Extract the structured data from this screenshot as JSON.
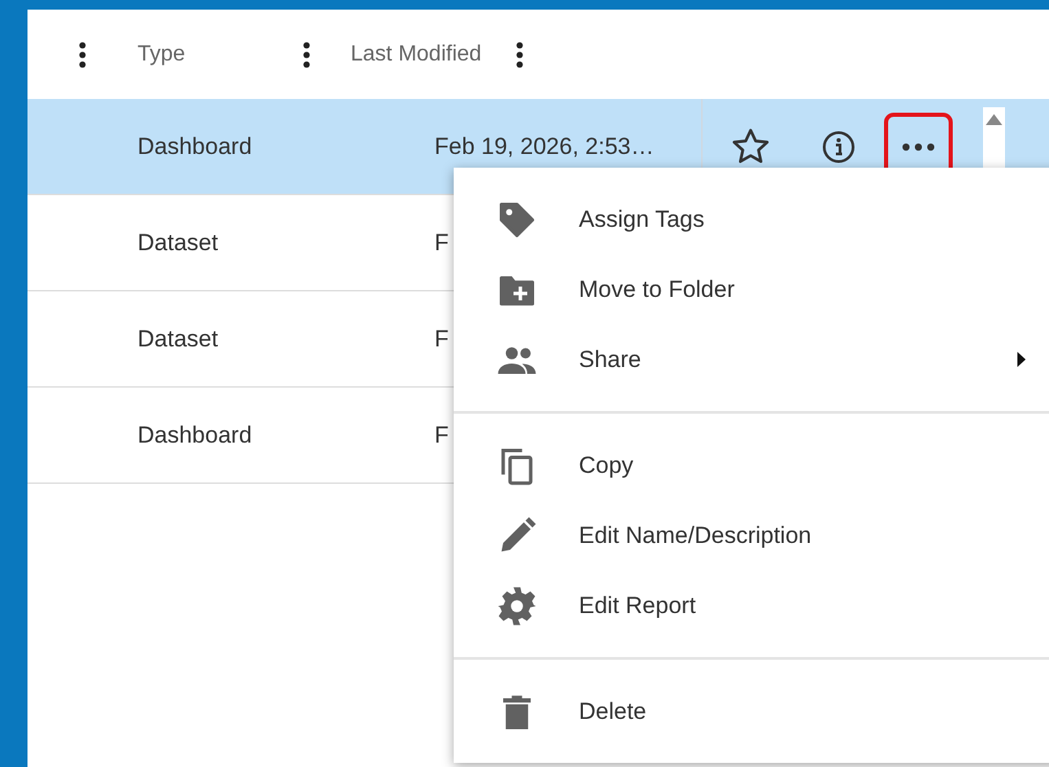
{
  "table": {
    "columns": [
      {
        "label": "Type"
      },
      {
        "label": "Last Modified"
      }
    ],
    "rows": [
      {
        "type": "Dashboard",
        "modified": "Feb 19, 2026, 2:53…",
        "selected": true
      },
      {
        "type": "Dataset",
        "modified": "F",
        "selected": false
      },
      {
        "type": "Dataset",
        "modified": "F",
        "selected": false
      },
      {
        "type": "Dashboard",
        "modified": "F",
        "selected": false
      }
    ]
  },
  "context_menu": {
    "groups": [
      [
        {
          "kind": "tag",
          "label": "Assign Tags",
          "submenu": false
        },
        {
          "kind": "folder",
          "label": "Move to Folder",
          "submenu": false
        },
        {
          "kind": "people",
          "label": "Share",
          "submenu": true
        }
      ],
      [
        {
          "kind": "copy",
          "label": "Copy",
          "submenu": false
        },
        {
          "kind": "pencil",
          "label": "Edit Name/Description",
          "submenu": false
        },
        {
          "kind": "gear",
          "label": "Edit Report",
          "submenu": false
        }
      ],
      [
        {
          "kind": "trash",
          "label": "Delete",
          "submenu": false
        }
      ]
    ]
  }
}
